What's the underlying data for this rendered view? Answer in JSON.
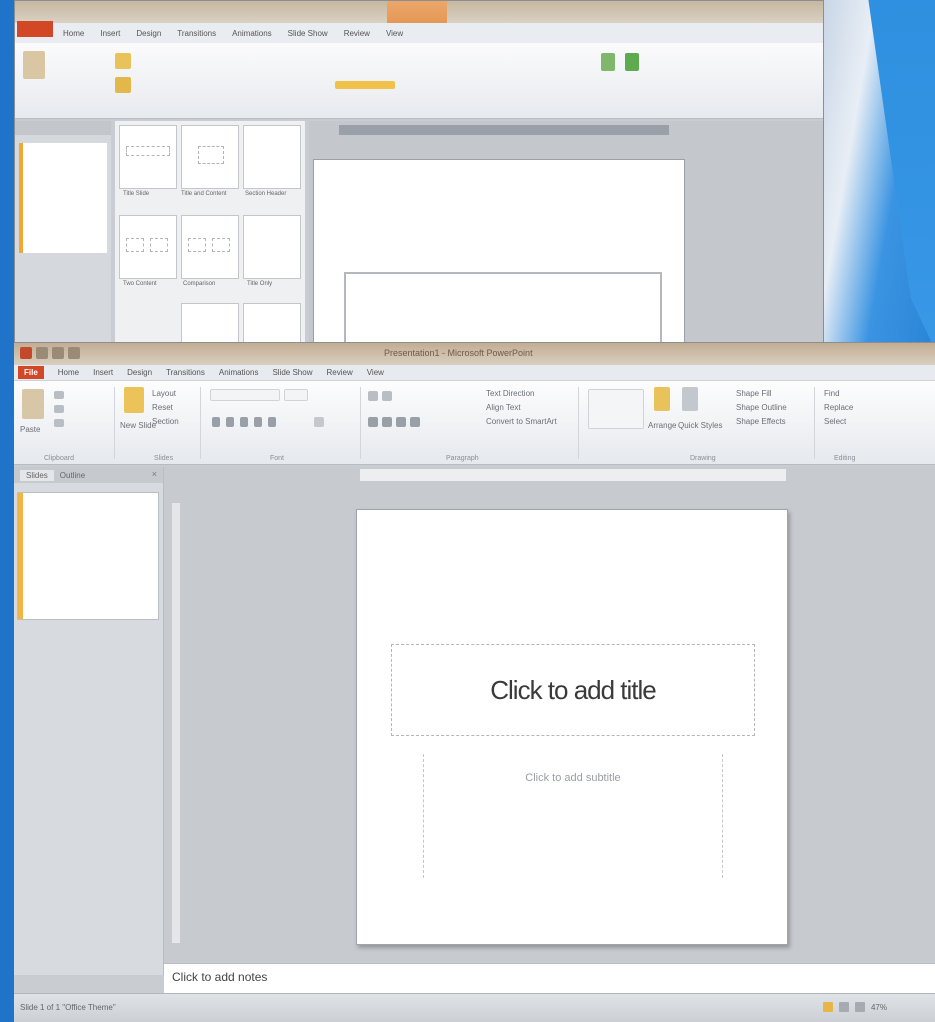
{
  "app": {
    "title": "Presentation1 - Microsoft PowerPoint",
    "file_tab": "File",
    "tabs": [
      "Home",
      "Insert",
      "Design",
      "Transitions",
      "Animations",
      "Slide Show",
      "Review",
      "View"
    ]
  },
  "ribbon": {
    "clipboard": {
      "paste": "Paste",
      "label": "Clipboard"
    },
    "slides": {
      "new_slide": "New Slide",
      "layout": "Layout",
      "reset": "Reset",
      "section": "Section",
      "label": "Slides"
    },
    "font": {
      "label": "Font"
    },
    "paragraph": {
      "text_direction": "Text Direction",
      "align_text": "Align Text",
      "convert": "Convert to SmartArt",
      "label": "Paragraph"
    },
    "drawing": {
      "arrange": "Arrange",
      "quick_styles": "Quick Styles",
      "shape_fill": "Shape Fill",
      "shape_outline": "Shape Outline",
      "shape_effects": "Shape Effects",
      "label": "Drawing"
    },
    "editing": {
      "find": "Find",
      "replace": "Replace",
      "select": "Select",
      "label": "Editing"
    }
  },
  "pane": {
    "tab_slides": "Slides",
    "tab_outline": "Outline",
    "close": "×"
  },
  "slide": {
    "title_placeholder": "Click to add title",
    "subtitle_placeholder": "Click to add subtitle"
  },
  "notes": {
    "placeholder": "Click to add notes"
  },
  "status": {
    "left": "Slide 1 of 1   \"Office Theme\"",
    "zoom": "47%"
  },
  "back_window": {
    "layouts": [
      "Title Slide",
      "Title and Content",
      "Section Header",
      "Two Content",
      "Comparison",
      "Title Only"
    ]
  },
  "colors": {
    "file_tab": "#d24726",
    "accent_orange": "#f2b544",
    "desktop_blue": "#2f8fe0"
  }
}
